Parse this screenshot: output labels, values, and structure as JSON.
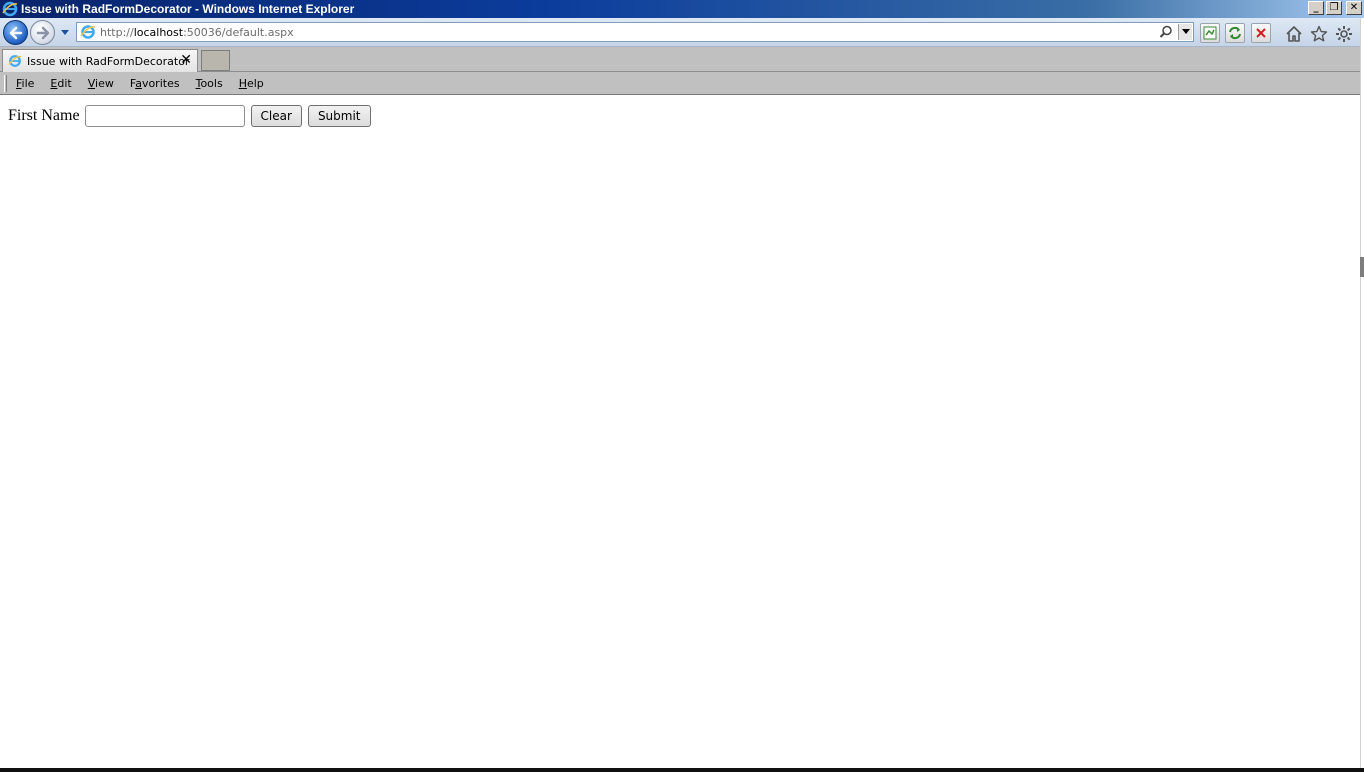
{
  "window": {
    "title": "Issue with RadFormDecorator - Windows Internet Explorer",
    "controls": {
      "minimize": "_",
      "restore": "❐",
      "close": "✕"
    }
  },
  "navbar": {
    "url_scheme": "http://",
    "url_host": "localhost",
    "url_rest": ":50036/default.aspx",
    "icons": [
      "back-icon",
      "forward-icon",
      "recent-pages-icon",
      "ie-page-icon",
      "search-icon",
      "compatibility-view-icon",
      "refresh-icon",
      "stop-icon",
      "home-icon",
      "favorites-star-icon",
      "gear-icon"
    ]
  },
  "tabs": [
    {
      "label": "Issue with RadFormDecorator",
      "close": "✕"
    }
  ],
  "menu": {
    "items": [
      {
        "pre": "",
        "key": "F",
        "post": "ile"
      },
      {
        "pre": "",
        "key": "E",
        "post": "dit"
      },
      {
        "pre": "",
        "key": "V",
        "post": "iew"
      },
      {
        "pre": "F",
        "key": "a",
        "post": "vorites"
      },
      {
        "pre": "",
        "key": "T",
        "post": "ools"
      },
      {
        "pre": "",
        "key": "H",
        "post": "elp"
      }
    ]
  },
  "form": {
    "label": "First Name",
    "input_value": "",
    "clear_label": "Clear",
    "submit_label": "Submit"
  },
  "colors": {
    "title_gradient_start": "#0a246a",
    "chrome_gray": "#c0c0c0",
    "address_border": "#7f9db9"
  }
}
